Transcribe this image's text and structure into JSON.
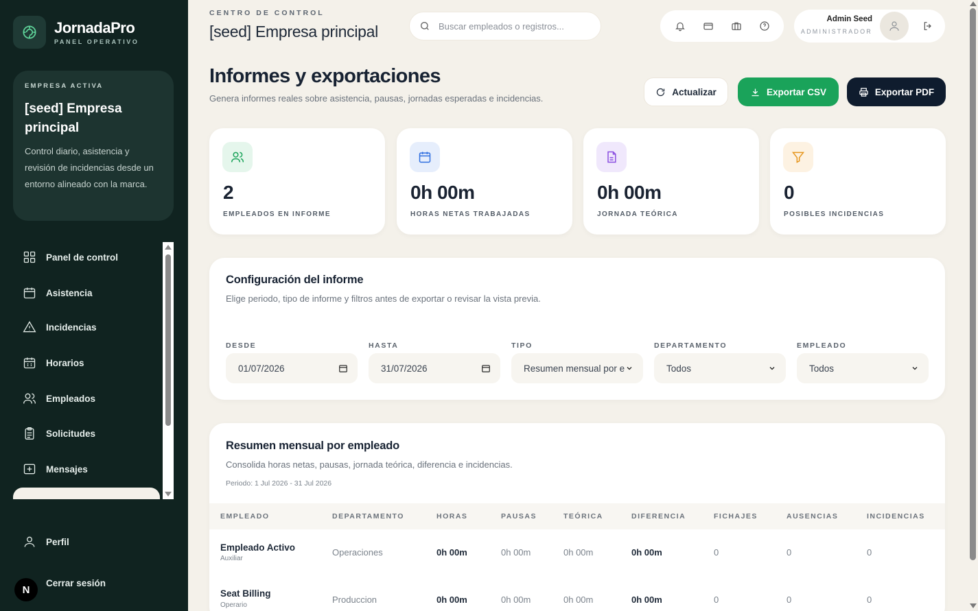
{
  "brand": {
    "name": "JornadaPro",
    "subtitle": "PANEL OPERATIVO"
  },
  "company_card": {
    "eyebrow": "EMPRESA ACTIVA",
    "name": "[seed] Empresa principal",
    "description": "Control diario, asistencia y revisión de incidencias desde un entorno alineado con la marca."
  },
  "nav": {
    "items": [
      {
        "label": "Panel de control",
        "icon": "dashboard-icon"
      },
      {
        "label": "Asistencia",
        "icon": "calendar-icon"
      },
      {
        "label": "Incidencias",
        "icon": "warning-icon"
      },
      {
        "label": "Horarios",
        "icon": "schedule-icon"
      },
      {
        "label": "Empleados",
        "icon": "users-icon"
      },
      {
        "label": "Solicitudes",
        "icon": "clipboard-icon"
      },
      {
        "label": "Mensajes",
        "icon": "message-icon"
      }
    ],
    "profile": "Perfil",
    "logout": "Cerrar sesión",
    "avatar_letter": "N"
  },
  "topbar": {
    "eyebrow": "CENTRO DE CONTROL",
    "title": "[seed] Empresa principal",
    "search_placeholder": "Buscar empleados o registros...",
    "user_name": "Admin Seed",
    "user_role": "ADMINISTRADOR"
  },
  "header": {
    "title": "Informes y exportaciones",
    "subtitle": "Genera informes reales sobre asistencia, pausas, jornadas esperadas e incidencias.",
    "refresh_label": "Actualizar",
    "csv_label": "Exportar CSV",
    "pdf_label": "Exportar PDF"
  },
  "stats": [
    {
      "value": "2",
      "label": "EMPLEADOS EN INFORME",
      "icon": "users-icon",
      "color": "#1aa35a",
      "bg": "#e5f6ec"
    },
    {
      "value": "0h 00m",
      "label": "HORAS NETAS TRABAJADAS",
      "icon": "calendar-icon",
      "color": "#2f6fe0",
      "bg": "#e6eefc"
    },
    {
      "value": "0h 00m",
      "label": "JORNADA TEÓRICA",
      "icon": "document-icon",
      "color": "#8a4fe0",
      "bg": "#f0e8fc"
    },
    {
      "value": "0",
      "label": "POSIBLES INCIDENCIAS",
      "icon": "filter-icon",
      "color": "#e6961e",
      "bg": "#fdf2e2"
    }
  ],
  "config": {
    "title": "Configuración del informe",
    "description": "Elige periodo, tipo de informe y filtros antes de exportar o revisar la vista previa.",
    "fields": [
      {
        "label": "DESDE",
        "value": "01/07/2026"
      },
      {
        "label": "HASTA",
        "value": "31/07/2026"
      },
      {
        "label": "TIPO",
        "value": "Resumen mensual por e"
      },
      {
        "label": "DEPARTAMENTO",
        "value": "Todos"
      },
      {
        "label": "EMPLEADO",
        "value": "Todos"
      }
    ]
  },
  "summary": {
    "title": "Resumen mensual por empleado",
    "description": "Consolida horas netas, pausas, jornada teórica, diferencia e incidencias.",
    "period": "Periodo: 1 Jul 2026 - 31 Jul 2026",
    "columns": [
      "EMPLEADO",
      "DEPARTAMENTO",
      "HORAS",
      "PAUSAS",
      "TEÓRICA",
      "DIFERENCIA",
      "FICHAJES",
      "AUSENCIAS",
      "INCIDENCIAS"
    ],
    "rows": [
      {
        "name": "Empleado Activo",
        "role": "Auxiliar",
        "department": "Operaciones",
        "hours": "0h 00m",
        "breaks": "0h 00m",
        "theoretical": "0h 00m",
        "difference": "0h 00m",
        "punches": "0",
        "absences": "0",
        "incidents": "0"
      },
      {
        "name": "Seat Billing",
        "role": "Operario",
        "department": "Produccion",
        "hours": "0h 00m",
        "breaks": "0h 00m",
        "theoretical": "0h 00m",
        "difference": "0h 00m",
        "punches": "0",
        "absences": "0",
        "incidents": "0"
      }
    ]
  }
}
